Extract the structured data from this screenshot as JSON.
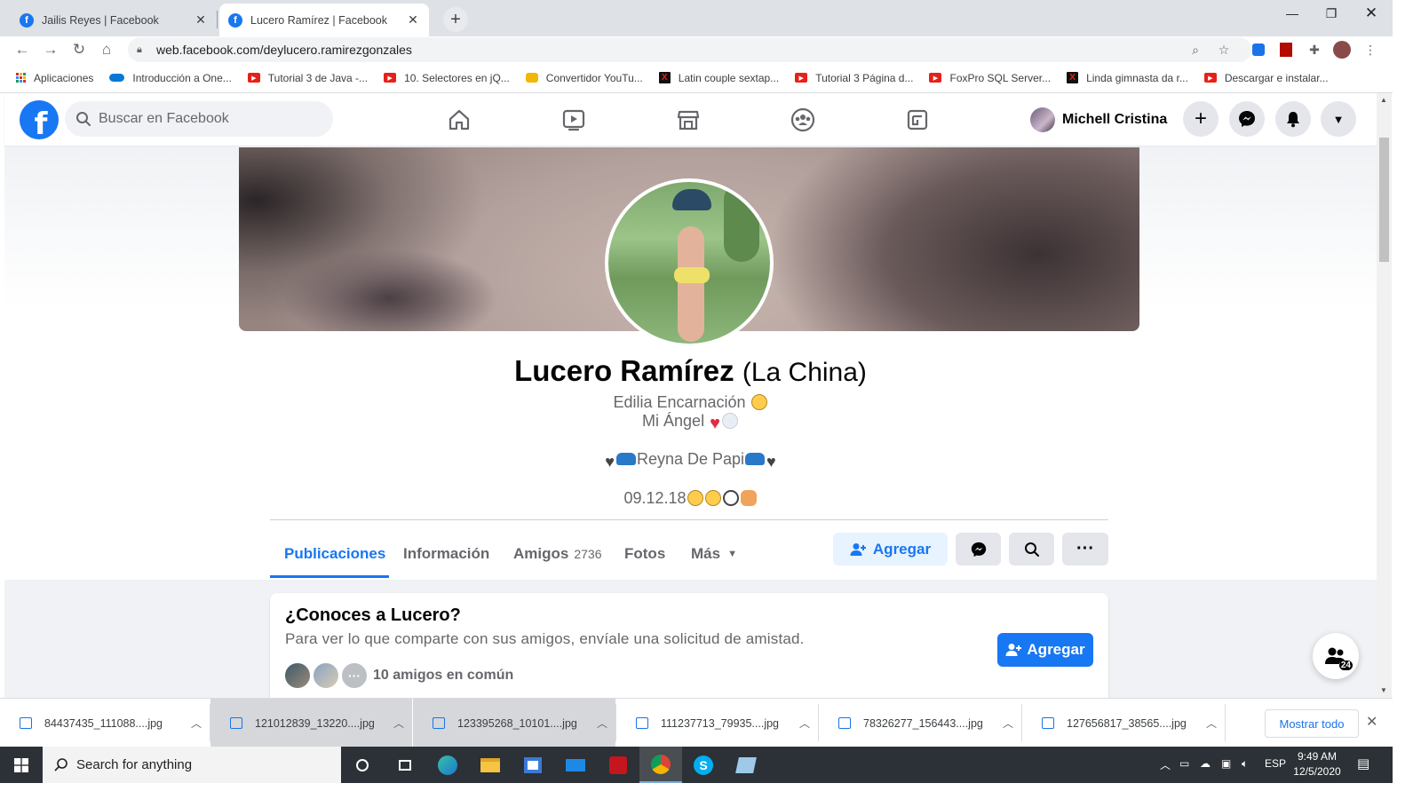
{
  "browser": {
    "tabs": [
      {
        "title": "Jailis Reyes | Facebook",
        "active": false
      },
      {
        "title": "Lucero Ramírez | Facebook",
        "active": true
      }
    ],
    "url": "web.facebook.com/deylucero.ramirezgonzales",
    "bookmarks": [
      {
        "label": "Aplicaciones",
        "icon": "apps-icon"
      },
      {
        "label": "Introducción a One...",
        "icon": "onedrive-icon"
      },
      {
        "label": "Tutorial 3 de Java -...",
        "icon": "youtube-icon"
      },
      {
        "label": "10. Selectores en jQ...",
        "icon": "youtube-icon"
      },
      {
        "label": "Convertidor YouTu...",
        "icon": "converter-icon"
      },
      {
        "label": "Latin couple sextap...",
        "icon": "x-site-icon"
      },
      {
        "label": "Tutorial 3 Página d...",
        "icon": "youtube-icon"
      },
      {
        "label": "FoxPro SQL Server...",
        "icon": "youtube-icon"
      },
      {
        "label": "Linda gimnasta da r...",
        "icon": "x-site-icon"
      },
      {
        "label": "Descargar e instalar...",
        "icon": "youtube-icon"
      }
    ]
  },
  "fb": {
    "search_placeholder": "Buscar en Facebook",
    "user_name": "Michell Cristina"
  },
  "profile": {
    "name": "Lucero Ramírez",
    "alt_name": "(La China)",
    "bio_line1": "Edilia Encarnación",
    "bio_line2": "Mi Ángel",
    "bio_line3": "Reyna De Papi",
    "bio_line4": "09.12.18",
    "tabs": [
      {
        "label": "Publicaciones"
      },
      {
        "label": "Información"
      },
      {
        "label": "Amigos",
        "count": "2736"
      },
      {
        "label": "Fotos"
      },
      {
        "label": "Más"
      }
    ],
    "add_button": "Agregar"
  },
  "pymk": {
    "title": "¿Conoces a Lucero?",
    "subtitle": "Para ver lo que comparte con sus amigos, envíale una solicitud de amistad.",
    "add_button": "Agregar",
    "mutual": "10 amigos en común"
  },
  "chat": {
    "online_count": "24"
  },
  "downloads": {
    "items": [
      "84437435_111088....jpg",
      "121012839_13220....jpg",
      "123395268_10101....jpg",
      "111237713_79935....jpg",
      "78326277_156443....jpg",
      "127656817_38565....jpg"
    ],
    "show_all": "Mostrar todo"
  },
  "taskbar": {
    "search_placeholder": "Search for anything",
    "lang": "ESP",
    "time": "9:49 AM",
    "date": "12/5/2020"
  }
}
